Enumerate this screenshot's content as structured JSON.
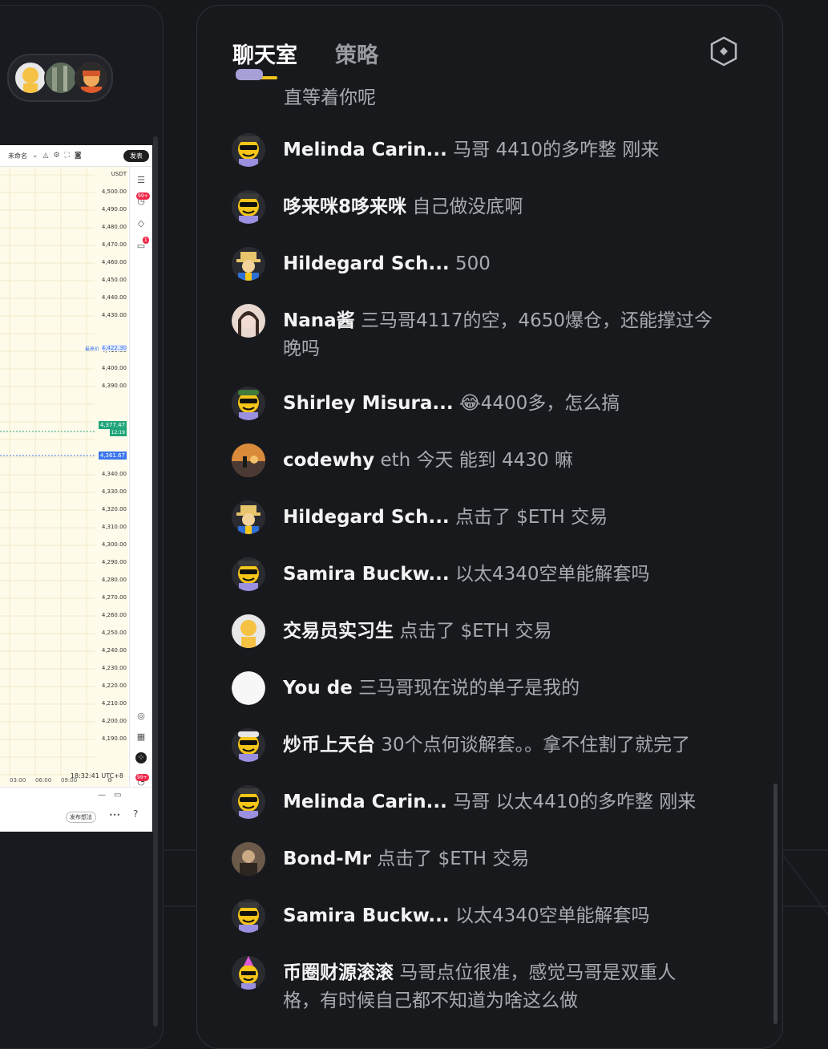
{
  "left_panel": {
    "chart": {
      "toolbar_name": "未命名",
      "toolbar_publish": "发表",
      "badge_99": "99+",
      "badge_1": "1",
      "prices": [
        "USDT",
        "4,500.00",
        "4,490.00",
        "4,480.00",
        "4,470.00",
        "4,460.00",
        "4,450.00",
        "4,440.00",
        "4,430.00",
        "4,410.00",
        "4,400.00",
        "4,390.00",
        "4,350.00",
        "4,340.00",
        "4,330.00",
        "4,320.00",
        "4,310.00",
        "4,300.00",
        "4,290.00",
        "4,280.00",
        "4,270.00",
        "4,260.00",
        "4,250.00",
        "4,240.00",
        "4,230.00",
        "4,220.00",
        "4,210.00",
        "4,200.00",
        "4,190.00"
      ],
      "marked_price_label": "最高价",
      "marked_price": "4,422.30",
      "green_price": "4,377.47",
      "green_sub": "12:19",
      "blue_price": "4,361.67",
      "time_labels": [
        "03:00",
        "06:00",
        "09:00"
      ],
      "utc": "18:32:41 UTC+8",
      "badge_99_bottom": "99+",
      "publish_draft": "发布想法"
    }
  },
  "chat": {
    "tabs": [
      {
        "label": "聊天室",
        "active": true
      },
      {
        "label": "策略",
        "active": false
      }
    ],
    "first_partial_text": "直等着你呢",
    "messages": [
      {
        "user": "Melinda Carin...",
        "text": "马哥 4410的多咋整 刚来",
        "avatar": "yellow-cool"
      },
      {
        "user": "哆来咪8哆来咪",
        "text": "自己做没底啊",
        "avatar": "yellow-cool"
      },
      {
        "user": "Hildegard Sch...",
        "text": "500",
        "avatar": "hat-blue"
      },
      {
        "user": "Nana酱",
        "text": "三马哥4117的空，4650爆仓，还能撑过今",
        "text2": "晚吗",
        "avatar": "photo-girl"
      },
      {
        "user": "Shirley Misura...",
        "text": "😂4400多，怎么搞",
        "avatar": "yellow-cool-green"
      },
      {
        "user": "codewhy",
        "text": "eth 今天 能到 4430 嘛",
        "avatar": "photo-sunset"
      },
      {
        "user": "Hildegard Sch...",
        "text": "点击了 $ETH 交易",
        "avatar": "hat-blue"
      },
      {
        "user": "Samira Buckw...",
        "text": "以太4340空单能解套吗",
        "avatar": "yellow-cool"
      },
      {
        "user": "交易员实习生",
        "text": "点击了 $ETH 交易",
        "avatar": "plain-yellow"
      },
      {
        "user": "You de",
        "text": "三马哥现在说的单子是我的",
        "avatar": "white"
      },
      {
        "user": "炒币上天台",
        "text": "30个点何谈解套。。拿不住割了就完了",
        "avatar": "yellow-cool-white"
      },
      {
        "user": "Melinda Carin...",
        "text": "马哥 以太4410的多咋整 刚来",
        "avatar": "yellow-cool"
      },
      {
        "user": "Bond-Mr",
        "text": "点击了 $ETH 交易",
        "avatar": "photo-dark"
      },
      {
        "user": "Samira Buckw...",
        "text": "以太4340空单能解套吗",
        "avatar": "yellow-cool"
      },
      {
        "user": "币圈财源滚滚",
        "text": "马哥点位很准，感觉马哥是双重人",
        "text2": "格，有时候自己都不知道为啥这么做",
        "avatar": "party-yellow"
      }
    ]
  },
  "colors": {
    "background": "#17181c",
    "accent": "#f0c419",
    "username": "#f3f3f4",
    "message": "#a9aab0"
  }
}
